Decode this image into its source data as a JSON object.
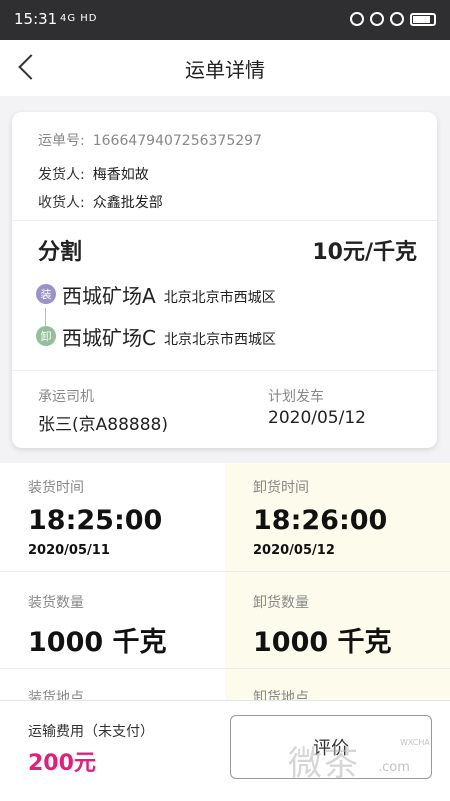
{
  "status_bar": {
    "time": "15:31",
    "network": "4G HD"
  },
  "nav": {
    "title": "运单详情"
  },
  "order": {
    "number_label": "运单号:",
    "number": "1666479407256375297",
    "shipper_label": "发货人:",
    "shipper": "梅香如故",
    "receiver_label": "收货人:",
    "receiver": "众鑫批发部",
    "cargo_type": "分割",
    "price": "10元/千克",
    "route": [
      {
        "badge": "装",
        "place": "西城矿场A",
        "address": "北京北京市西城区"
      },
      {
        "badge": "卸",
        "place": "西城矿场C",
        "address": "北京北京市西城区"
      }
    ],
    "driver_label": "承运司机",
    "driver": "张三(京A88888)",
    "departure_label": "计划发车",
    "departure": "2020/05/12"
  },
  "details": {
    "load_time_label": "装货时间",
    "load_time": "18:25:00",
    "load_date": "2020/05/11",
    "unload_time_label": "卸货时间",
    "unload_time": "18:26:00",
    "unload_date": "2020/05/12",
    "load_qty_label": "装货数量",
    "load_qty": "1000 千克",
    "unload_qty_label": "卸货数量",
    "unload_qty": "1000 千克",
    "load_place_label": "装货地点",
    "unload_place_label": "卸货地点"
  },
  "footer": {
    "fee_label": "运输费用（未支付）",
    "fee": "200元",
    "evaluate_label": "评价"
  },
  "watermark": {
    "text": "微茶",
    "sub": "WXCHA",
    "url": ".com"
  },
  "colors": {
    "fee": "#e0207a",
    "load_badge": "#9b92c7",
    "unload_badge": "#93bf9b",
    "right_col_bg": "#fdfcec"
  },
  "icons": [
    "back-arrow-icon",
    "wifi-icon",
    "lock-icon",
    "location-icon",
    "alarm-icon",
    "battery-icon"
  ]
}
